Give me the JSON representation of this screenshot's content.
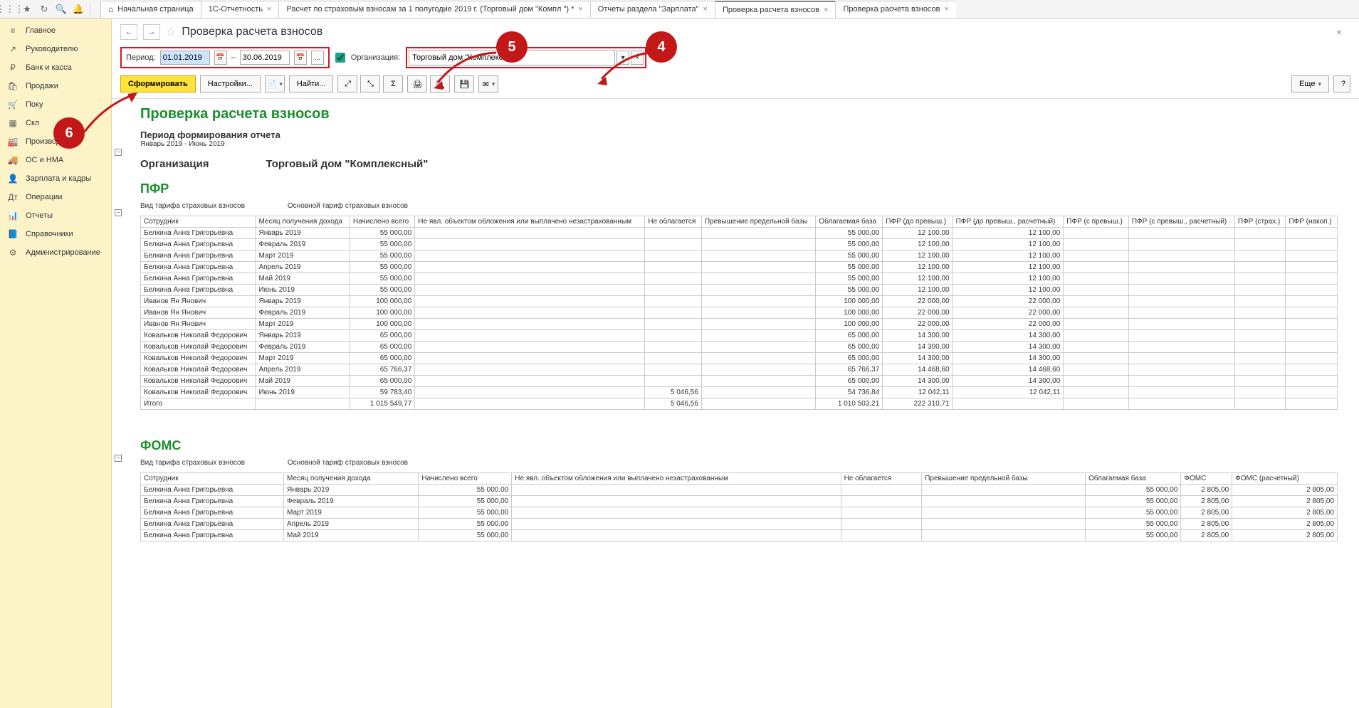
{
  "tabs": [
    {
      "label": "Начальная страница",
      "home": true,
      "close": false
    },
    {
      "label": "1С-Отчетность",
      "close": true
    },
    {
      "label": "Расчет по страховым взносам за 1 полугодие 2019 г. (Торговый дом \"Компл            \") *",
      "close": true
    },
    {
      "label": "Отчеты раздела \"Зарплата\"",
      "close": true
    },
    {
      "label": "Проверка расчета взносов",
      "close": true,
      "active": true
    },
    {
      "label": "Проверка расчета взносов",
      "close": true
    }
  ],
  "sidebar": [
    {
      "icon": "≡",
      "label": "Главное"
    },
    {
      "icon": "↗",
      "label": "Руководителю"
    },
    {
      "icon": "₽",
      "label": "Банк и касса"
    },
    {
      "icon": "🛍",
      "label": "Продажи"
    },
    {
      "icon": "🛒",
      "label": "Поку"
    },
    {
      "icon": "▦",
      "label": "Скл"
    },
    {
      "icon": "🏭",
      "label": "Производство"
    },
    {
      "icon": "🚚",
      "label": "ОС и НМА"
    },
    {
      "icon": "👤",
      "label": "Зарплата и кадры"
    },
    {
      "icon": "Дт",
      "label": "Операции"
    },
    {
      "icon": "📊",
      "label": "Отчеты"
    },
    {
      "icon": "📘",
      "label": "Справочники"
    },
    {
      "icon": "⚙",
      "label": "Администрирование"
    }
  ],
  "page": {
    "title": "Проверка расчета взносов",
    "period_label": "Период:",
    "date_from": "01.01.2019",
    "date_to": "30.06.2019",
    "dash": "–",
    "ellipsis": "...",
    "org_label": "Организация:",
    "org_value": "Торговый дом \"Комплексный\"",
    "btn_generate": "Сформировать",
    "btn_settings": "Настройки...",
    "btn_find": "Найти...",
    "btn_more": "Еще",
    "btn_help": "?"
  },
  "report": {
    "title": "Проверка расчета взносов",
    "period_h": "Период формирования отчета",
    "period_txt": "Январь 2019 - Июнь 2019",
    "org_h": "Организация",
    "org_v": "Торговый дом \"Комплексный\"",
    "tariff_label": "Вид тарифа страховых взносов",
    "tariff_value": "Основной тариф страховых взносов",
    "pfr": {
      "title": "ПФР",
      "headers": [
        "Сотрудник",
        "Месяц получения дохода",
        "Начислено всего",
        "Не явл. объектом обложения или выплачено незастрахованным",
        "Не облагается",
        "Превышение предельной базы",
        "Облагаемая база",
        "ПФР (до превыш.)",
        "ПФР (до превыш., расчетный)",
        "ПФР (с превыш.)",
        "ПФР (с превыш., расчетный)",
        "ПФР (страх.)",
        "ПФР (накоп.)"
      ],
      "rows": [
        [
          "Белкина Анна Григорьевна",
          "Январь 2019",
          "55 000,00",
          "",
          "",
          "",
          "55 000,00",
          "12 100,00",
          "12 100,00",
          "",
          "",
          "",
          ""
        ],
        [
          "Белкина Анна Григорьевна",
          "Февраль 2019",
          "55 000,00",
          "",
          "",
          "",
          "55 000,00",
          "12 100,00",
          "12 100,00",
          "",
          "",
          "",
          ""
        ],
        [
          "Белкина Анна Григорьевна",
          "Март 2019",
          "55 000,00",
          "",
          "",
          "",
          "55 000,00",
          "12 100,00",
          "12 100,00",
          "",
          "",
          "",
          ""
        ],
        [
          "Белкина Анна Григорьевна",
          "Апрель 2019",
          "55 000,00",
          "",
          "",
          "",
          "55 000,00",
          "12 100,00",
          "12 100,00",
          "",
          "",
          "",
          ""
        ],
        [
          "Белкина Анна Григорьевна",
          "Май 2019",
          "55 000,00",
          "",
          "",
          "",
          "55 000,00",
          "12 100,00",
          "12 100,00",
          "",
          "",
          "",
          ""
        ],
        [
          "Белкина Анна Григорьевна",
          "Июнь 2019",
          "55 000,00",
          "",
          "",
          "",
          "55 000,00",
          "12 100,00",
          "12 100,00",
          "",
          "",
          "",
          ""
        ],
        [
          "Иванов Ян Янович",
          "Январь 2019",
          "100 000,00",
          "",
          "",
          "",
          "100 000,00",
          "22 000,00",
          "22 000,00",
          "",
          "",
          "",
          ""
        ],
        [
          "Иванов Ян Янович",
          "Февраль 2019",
          "100 000,00",
          "",
          "",
          "",
          "100 000,00",
          "22 000,00",
          "22 000,00",
          "",
          "",
          "",
          ""
        ],
        [
          "Иванов Ян Янович",
          "Март 2019",
          "100 000,00",
          "",
          "",
          "",
          "100 000,00",
          "22 000,00",
          "22 000,00",
          "",
          "",
          "",
          ""
        ],
        [
          "Ковальков Николай Федорович",
          "Январь 2019",
          "65 000,00",
          "",
          "",
          "",
          "65 000,00",
          "14 300,00",
          "14 300,00",
          "",
          "",
          "",
          ""
        ],
        [
          "Ковальков Николай Федорович",
          "Февраль 2019",
          "65 000,00",
          "",
          "",
          "",
          "65 000,00",
          "14 300,00",
          "14 300,00",
          "",
          "",
          "",
          ""
        ],
        [
          "Ковальков Николай Федорович",
          "Март 2019",
          "65 000,00",
          "",
          "",
          "",
          "65 000,00",
          "14 300,00",
          "14 300,00",
          "",
          "",
          "",
          ""
        ],
        [
          "Ковальков Николай Федорович",
          "Апрель 2019",
          "65 766,37",
          "",
          "",
          "",
          "65 766,37",
          "14 468,60",
          "14 468,60",
          "",
          "",
          "",
          ""
        ],
        [
          "Ковальков Николай Федорович",
          "Май 2019",
          "65 000,00",
          "",
          "",
          "",
          "65 000,00",
          "14 300,00",
          "14 300,00",
          "",
          "",
          "",
          ""
        ],
        [
          "Ковальков Николай Федорович",
          "Июнь 2019",
          "59 783,40",
          "",
          "5 046,56",
          "",
          "54 736,84",
          "12 042,11",
          "12 042,11",
          "",
          "",
          "",
          ""
        ]
      ],
      "total": [
        "Итого",
        "",
        "1 015 549,77",
        "",
        "5 046,56",
        "",
        "1 010 503,21",
        "222 310,71",
        "",
        "",
        "",
        "",
        ""
      ]
    },
    "foms": {
      "title": "ФОМС",
      "headers": [
        "Сотрудник",
        "Месяц получения дохода",
        "Начислено всего",
        "Не явл. объектом обложения или выплачено незастрахованным",
        "Не облагается",
        "Превышение предельной базы",
        "Облагаемая база",
        "ФОМС",
        "ФОМС (расчетный)"
      ],
      "rows": [
        [
          "Белкина Анна Григорьевна",
          "Январь 2019",
          "55 000,00",
          "",
          "",
          "",
          "55 000,00",
          "2 805,00",
          "2 805,00"
        ],
        [
          "Белкина Анна Григорьевна",
          "Февраль 2019",
          "55 000,00",
          "",
          "",
          "",
          "55 000,00",
          "2 805,00",
          "2 805,00"
        ],
        [
          "Белкина Анна Григорьевна",
          "Март 2019",
          "55 000,00",
          "",
          "",
          "",
          "55 000,00",
          "2 805,00",
          "2 805,00"
        ],
        [
          "Белкина Анна Григорьевна",
          "Апрель 2019",
          "55 000,00",
          "",
          "",
          "",
          "55 000,00",
          "2 805,00",
          "2 805,00"
        ],
        [
          "Белкина Анна Григорьевна",
          "Май 2019",
          "55 000,00",
          "",
          "",
          "",
          "55 000,00",
          "2 805,00",
          "2 805,00"
        ]
      ]
    }
  },
  "balloons": {
    "b4": "4",
    "b5": "5",
    "b6": "6"
  }
}
